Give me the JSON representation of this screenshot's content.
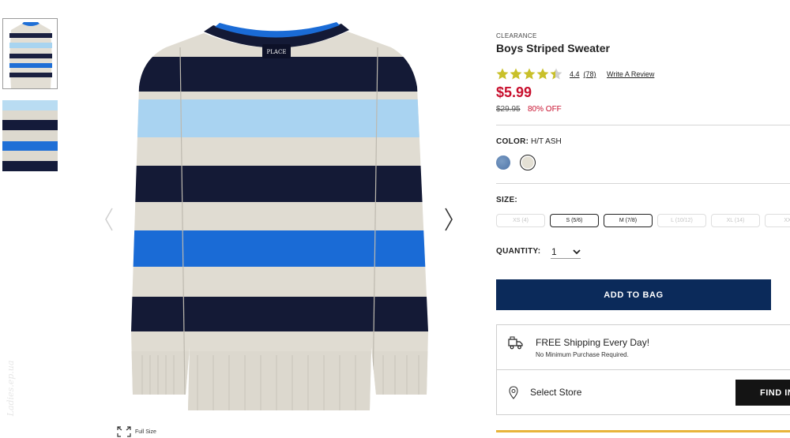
{
  "gallery": {
    "full_size_label": "Full Size",
    "watermark": "Ladies.ep.ua"
  },
  "product": {
    "eyebrow": "CLEARANCE",
    "name": "Boys Striped Sweater",
    "rating_value": "4.4",
    "rating_count": "(78)",
    "rating_stars": 4.4,
    "write_review": "Write A Review",
    "price": "$5.99",
    "original_price": "$29.95",
    "discount": "80% OFF"
  },
  "color": {
    "label": "COLOR:",
    "selected": "H/T ASH",
    "swatches": [
      "blue-heather-icon",
      "ash-icon"
    ]
  },
  "size": {
    "label": "SIZE:",
    "options": [
      {
        "label": "XS (4)",
        "available": false
      },
      {
        "label": "S (5/6)",
        "available": true
      },
      {
        "label": "M (7/8)",
        "available": true
      },
      {
        "label": "L (10/12)",
        "available": false
      },
      {
        "label": "XL (14)",
        "available": false
      },
      {
        "label": "XXL",
        "available": false
      }
    ]
  },
  "quantity": {
    "label": "QUANTITY:",
    "value": "1"
  },
  "actions": {
    "add_to_bag": "ADD TO BAG"
  },
  "shipping": {
    "title": "FREE Shipping Every Day!",
    "subtitle": "No Minimum Purchase Required.",
    "store_label": "Select Store",
    "find_label": "FIND IN"
  },
  "colors": {
    "price_red": "#c8102e",
    "button_navy": "#0b2a5a",
    "accent_gold": "#e8b43a"
  }
}
